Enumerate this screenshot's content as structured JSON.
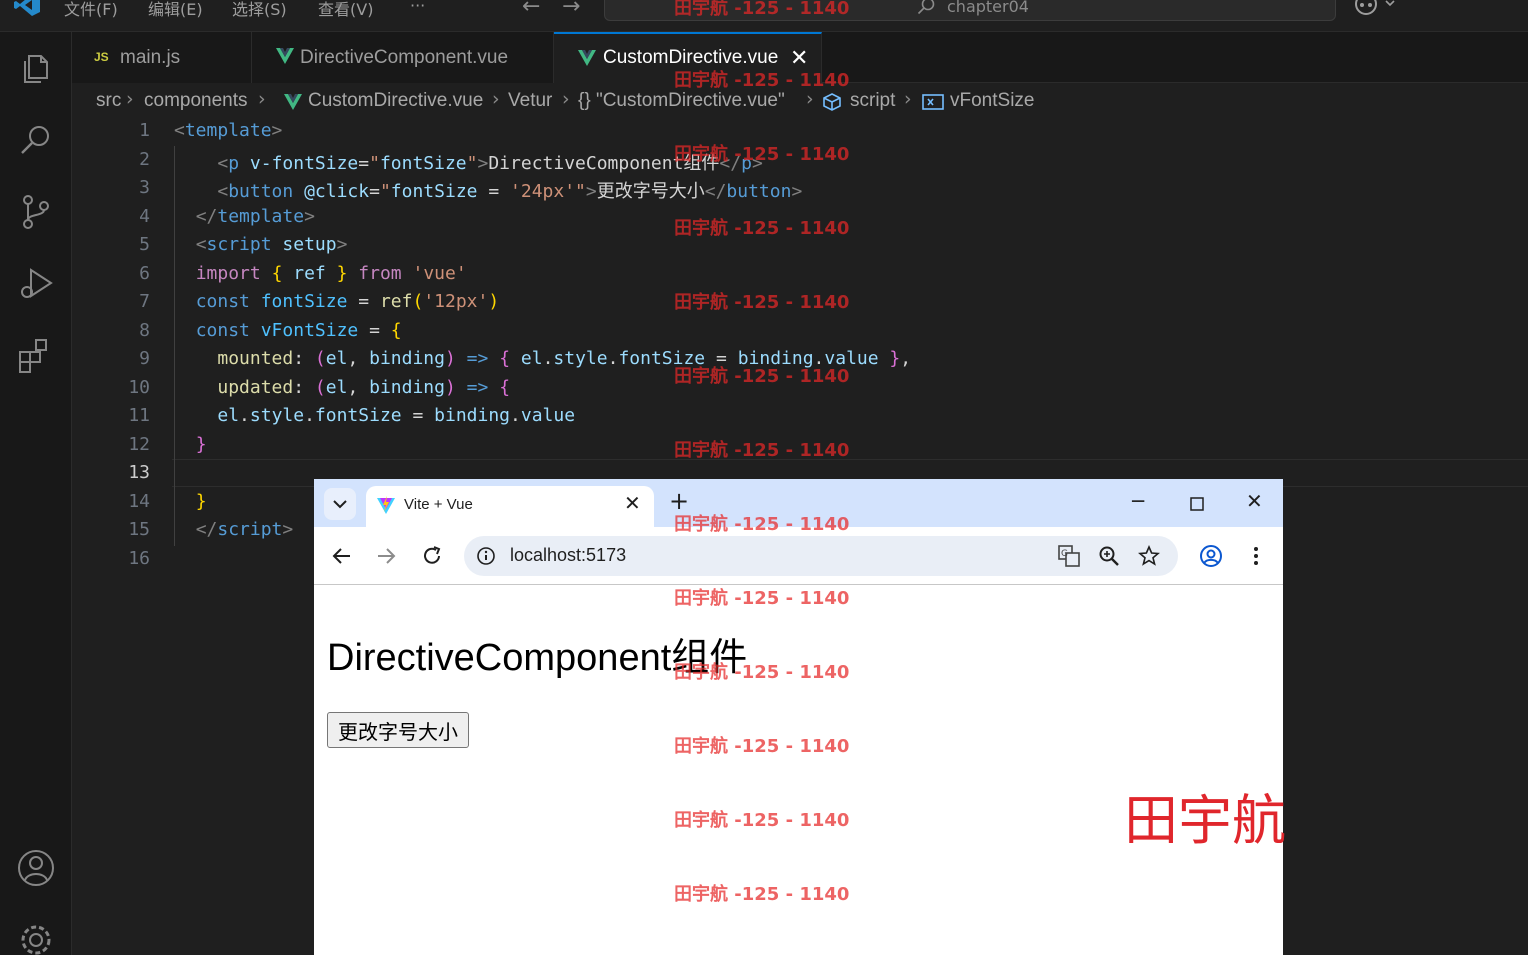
{
  "menu": {
    "file": "文件(F)",
    "edit": "编辑(E)",
    "selection": "选择(S)",
    "view": "查看(V)",
    "more": "···"
  },
  "command_center": {
    "text": "chapter04"
  },
  "tabs": [
    {
      "label": "main.js",
      "badge": "JS"
    },
    {
      "label": "DirectiveComponent.vue"
    },
    {
      "label": "CustomDirective.vue",
      "close": "✕"
    }
  ],
  "breadcrumb": [
    "src",
    "components",
    "CustomDirective.vue",
    "Vetur",
    "{} \"CustomDirective.vue\"",
    "script",
    "vFontSize"
  ],
  "editor": {
    "line_numbers": [
      "1",
      "2",
      "3",
      "4",
      "5",
      "6",
      "7",
      "8",
      "9",
      "10",
      "11",
      "12",
      "13",
      "14",
      "15",
      "16"
    ],
    "current_line": "13"
  },
  "browser": {
    "tab_title": "Vite + Vue",
    "address": "localhost:5173",
    "page_text": "DirectiveComponent组件",
    "page_button": "更改字号大小",
    "name_overlay": "田宇航"
  },
  "watermark": "田宇航 -125 - 1140",
  "colors": {
    "accent": "#0078d4",
    "vue_green": "#41b883",
    "watermark": "#e6282a"
  }
}
